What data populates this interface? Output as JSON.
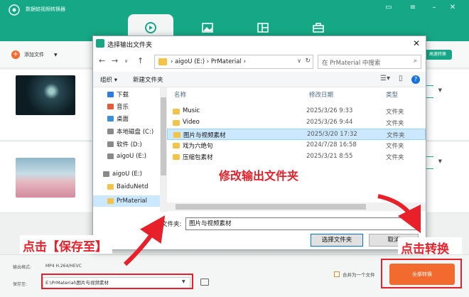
{
  "app": {
    "title": "数据蛙视频转换器",
    "add_file": "添加文件",
    "fast_convert": "高速转换",
    "output_format_label": "输出格式:",
    "output_format_value": "MP4 H.264/HEVC",
    "save_to_label": "保存至:",
    "save_path": "E:\\PrMaterial\\图片与视频素材",
    "merge_label": "合并为一个文件",
    "convert_all": "全部转换",
    "tabs": [
      "convert",
      "mv",
      "collage",
      "toolbox"
    ]
  },
  "dialog": {
    "title": "选择输出文件夹",
    "breadcrumb": "›  aigoU (E:)  ›  PrMaterial  ›",
    "search_placeholder": "在 PrMaterial 中搜索",
    "organize": "组织 ▾",
    "new_folder": "新建文件夹",
    "nav": [
      {
        "label": "下载",
        "icon": "download-icon",
        "color": "#2c7be5"
      },
      {
        "label": "音乐",
        "icon": "music-icon",
        "color": "#e25a3b"
      },
      {
        "label": "桌面",
        "icon": "desktop-icon",
        "color": "#3a8fd9"
      },
      {
        "label": "本地磁盘 (C:)",
        "icon": "drive-icon",
        "color": "#8a8a8a"
      },
      {
        "label": "软件 (D:)",
        "icon": "drive-icon",
        "color": "#8a8a8a"
      },
      {
        "label": "aigoU (E:)",
        "icon": "drive-icon",
        "color": "#8a8a8a"
      },
      {
        "label": "aigoU (E:)",
        "icon": "drive-icon",
        "color": "#8a8a8a"
      },
      {
        "label": "BaiduNetd",
        "icon": "folder-icon",
        "color": "#f3c44a"
      },
      {
        "label": "PrMaterial",
        "icon": "folder-icon",
        "color": "#f3c44a"
      }
    ],
    "columns": {
      "name": "名称",
      "date": "修改日期",
      "type": "类型"
    },
    "files": [
      {
        "name": "Music",
        "date": "2025/3/26 9:33",
        "type": "文件夹"
      },
      {
        "name": "Video",
        "date": "2025/3/26 9:44",
        "type": "文件夹"
      },
      {
        "name": "图片与视频素材",
        "date": "2025/3/20 17:32",
        "type": "文件夹"
      },
      {
        "name": "戏为六绝句",
        "date": "2024/7/28 16:58",
        "type": "文件夹"
      },
      {
        "name": "压缩包素材",
        "date": "2025/3/21 8:55",
        "type": "文件夹"
      }
    ],
    "folder_label": "文件夹:",
    "folder_value": "图片与视频素材",
    "select_button": "选择文件夹",
    "cancel_button": "取消"
  },
  "annotations": {
    "modify_folder": "修改输出文件夹",
    "click_save": "点击【保存至】",
    "click_convert": "点击转换"
  },
  "colors": {
    "accent": "#16a886",
    "convert": "#f26a2e",
    "annotation": "#e8202a"
  }
}
